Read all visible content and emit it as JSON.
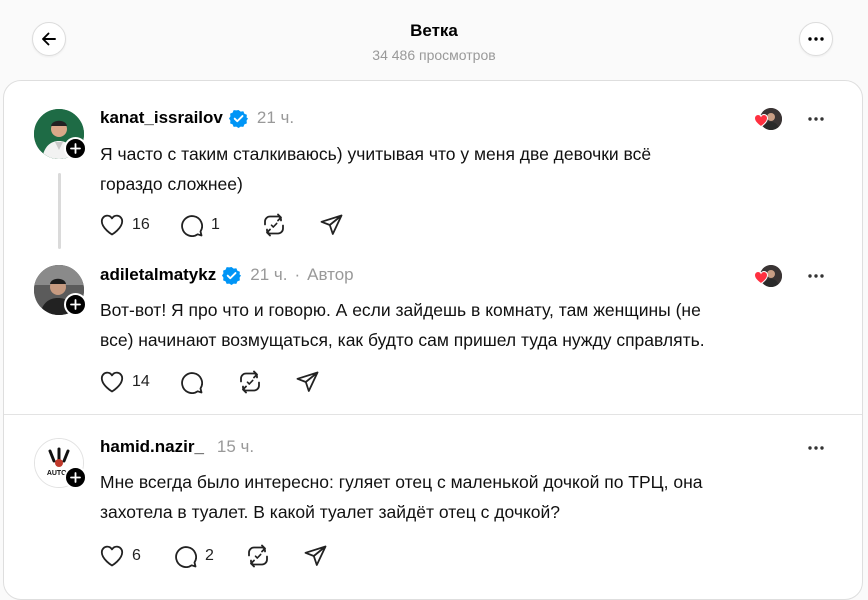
{
  "header": {
    "title": "Ветка",
    "views": "34 486 просмотров"
  },
  "posts": [
    {
      "username": "kanat_issrailov",
      "time": "21 ч.",
      "text1": "Я часто с таким сталкиваюсь) учитывая что у меня две девочки всё",
      "text2": "гораздо сложнее)",
      "likes": "16",
      "replies": "1"
    },
    {
      "username": "adiletalmatykz",
      "time": "21 ч.",
      "dot": "·",
      "author": "Автор",
      "text1": "Вот-вот! Я про что и говорю. А если зайдешь в комнату, там женщины (не",
      "text2": "все) начинают возмущаться, как будто сам пришел туда нужду справлять.",
      "likes": "14"
    },
    {
      "username": "hamid.nazir_",
      "time": "15 ч.",
      "avatar_text": "AUTOP",
      "text1": "Мне всегда было интересно: гуляет отец с маленькой дочкой по ТРЦ, она",
      "text2": "захотела в туалет. В какой туалет зайдёт отец с дочкой?",
      "likes": "6",
      "replies": "2"
    }
  ],
  "colors": {
    "verified": "#0095f6",
    "heart": "#ff3040",
    "muted": "#999999"
  },
  "icons": [
    "back-arrow-icon",
    "more-icon",
    "verified-icon",
    "heart-icon",
    "comment-icon",
    "repost-icon",
    "share-icon",
    "plus-icon"
  ]
}
